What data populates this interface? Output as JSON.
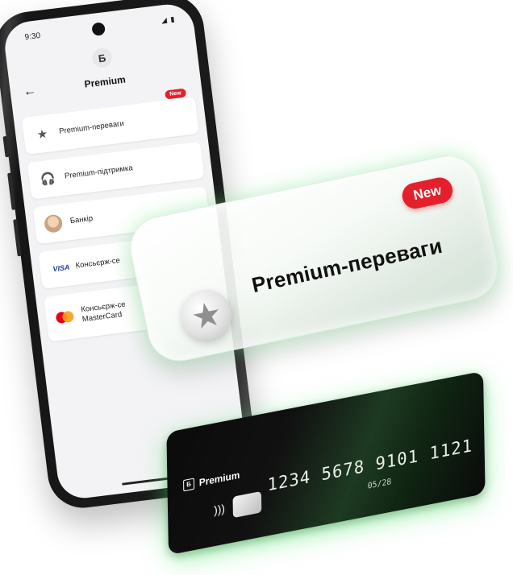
{
  "phone": {
    "status_time": "9:30",
    "status_icons": "◢ ▮",
    "logo_glyph": "Б",
    "back_glyph": "←",
    "title": "Premium",
    "items": [
      {
        "label": "Premium-переваги",
        "icon": "star-icon",
        "glyph": "★",
        "badge": "New"
      },
      {
        "label": "Premium-підтримка",
        "icon": "headset-icon",
        "glyph": "🎧"
      },
      {
        "label": "Банкір",
        "icon": "avatar-icon",
        "glyph": ""
      },
      {
        "label": "Консьєрж-се",
        "icon": "visa-icon",
        "glyph": "VISA"
      },
      {
        "label_line1": "Консьєрж-се",
        "label_line2": "MasterCard",
        "icon": "mastercard-icon"
      }
    ]
  },
  "glass_card": {
    "title": "Premium-переваги",
    "badge": "New",
    "icon": "star-icon",
    "star_glyph": "★"
  },
  "bank_card": {
    "brand": "Premium",
    "brand_logo": "Б",
    "contactless_glyph": ")))",
    "number": "1234 5678 9101 1121",
    "expiry": "05/28"
  },
  "colors": {
    "accent_red": "#e3202b",
    "glow_green": "#50e66e"
  }
}
